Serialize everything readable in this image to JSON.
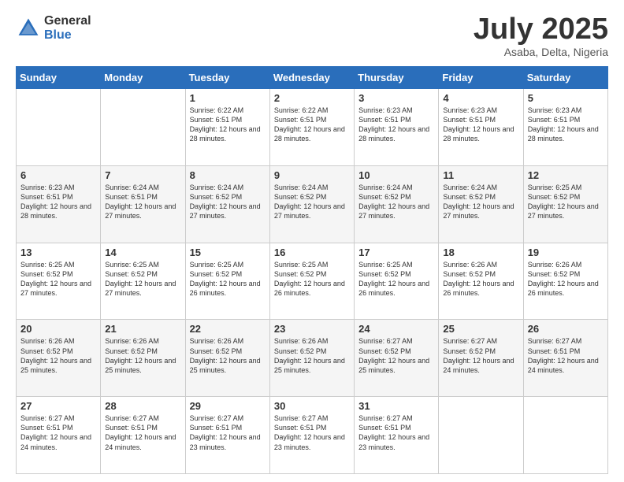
{
  "logo": {
    "general": "General",
    "blue": "Blue"
  },
  "header": {
    "month": "July 2025",
    "location": "Asaba, Delta, Nigeria"
  },
  "days_of_week": [
    "Sunday",
    "Monday",
    "Tuesday",
    "Wednesday",
    "Thursday",
    "Friday",
    "Saturday"
  ],
  "weeks": [
    [
      {
        "day": "",
        "sunrise": "",
        "sunset": "",
        "daylight": ""
      },
      {
        "day": "",
        "sunrise": "",
        "sunset": "",
        "daylight": ""
      },
      {
        "day": "1",
        "sunrise": "Sunrise: 6:22 AM",
        "sunset": "Sunset: 6:51 PM",
        "daylight": "Daylight: 12 hours and 28 minutes."
      },
      {
        "day": "2",
        "sunrise": "Sunrise: 6:22 AM",
        "sunset": "Sunset: 6:51 PM",
        "daylight": "Daylight: 12 hours and 28 minutes."
      },
      {
        "day": "3",
        "sunrise": "Sunrise: 6:23 AM",
        "sunset": "Sunset: 6:51 PM",
        "daylight": "Daylight: 12 hours and 28 minutes."
      },
      {
        "day": "4",
        "sunrise": "Sunrise: 6:23 AM",
        "sunset": "Sunset: 6:51 PM",
        "daylight": "Daylight: 12 hours and 28 minutes."
      },
      {
        "day": "5",
        "sunrise": "Sunrise: 6:23 AM",
        "sunset": "Sunset: 6:51 PM",
        "daylight": "Daylight: 12 hours and 28 minutes."
      }
    ],
    [
      {
        "day": "6",
        "sunrise": "Sunrise: 6:23 AM",
        "sunset": "Sunset: 6:51 PM",
        "daylight": "Daylight: 12 hours and 28 minutes."
      },
      {
        "day": "7",
        "sunrise": "Sunrise: 6:24 AM",
        "sunset": "Sunset: 6:51 PM",
        "daylight": "Daylight: 12 hours and 27 minutes."
      },
      {
        "day": "8",
        "sunrise": "Sunrise: 6:24 AM",
        "sunset": "Sunset: 6:52 PM",
        "daylight": "Daylight: 12 hours and 27 minutes."
      },
      {
        "day": "9",
        "sunrise": "Sunrise: 6:24 AM",
        "sunset": "Sunset: 6:52 PM",
        "daylight": "Daylight: 12 hours and 27 minutes."
      },
      {
        "day": "10",
        "sunrise": "Sunrise: 6:24 AM",
        "sunset": "Sunset: 6:52 PM",
        "daylight": "Daylight: 12 hours and 27 minutes."
      },
      {
        "day": "11",
        "sunrise": "Sunrise: 6:24 AM",
        "sunset": "Sunset: 6:52 PM",
        "daylight": "Daylight: 12 hours and 27 minutes."
      },
      {
        "day": "12",
        "sunrise": "Sunrise: 6:25 AM",
        "sunset": "Sunset: 6:52 PM",
        "daylight": "Daylight: 12 hours and 27 minutes."
      }
    ],
    [
      {
        "day": "13",
        "sunrise": "Sunrise: 6:25 AM",
        "sunset": "Sunset: 6:52 PM",
        "daylight": "Daylight: 12 hours and 27 minutes."
      },
      {
        "day": "14",
        "sunrise": "Sunrise: 6:25 AM",
        "sunset": "Sunset: 6:52 PM",
        "daylight": "Daylight: 12 hours and 27 minutes."
      },
      {
        "day": "15",
        "sunrise": "Sunrise: 6:25 AM",
        "sunset": "Sunset: 6:52 PM",
        "daylight": "Daylight: 12 hours and 26 minutes."
      },
      {
        "day": "16",
        "sunrise": "Sunrise: 6:25 AM",
        "sunset": "Sunset: 6:52 PM",
        "daylight": "Daylight: 12 hours and 26 minutes."
      },
      {
        "day": "17",
        "sunrise": "Sunrise: 6:25 AM",
        "sunset": "Sunset: 6:52 PM",
        "daylight": "Daylight: 12 hours and 26 minutes."
      },
      {
        "day": "18",
        "sunrise": "Sunrise: 6:26 AM",
        "sunset": "Sunset: 6:52 PM",
        "daylight": "Daylight: 12 hours and 26 minutes."
      },
      {
        "day": "19",
        "sunrise": "Sunrise: 6:26 AM",
        "sunset": "Sunset: 6:52 PM",
        "daylight": "Daylight: 12 hours and 26 minutes."
      }
    ],
    [
      {
        "day": "20",
        "sunrise": "Sunrise: 6:26 AM",
        "sunset": "Sunset: 6:52 PM",
        "daylight": "Daylight: 12 hours and 25 minutes."
      },
      {
        "day": "21",
        "sunrise": "Sunrise: 6:26 AM",
        "sunset": "Sunset: 6:52 PM",
        "daylight": "Daylight: 12 hours and 25 minutes."
      },
      {
        "day": "22",
        "sunrise": "Sunrise: 6:26 AM",
        "sunset": "Sunset: 6:52 PM",
        "daylight": "Daylight: 12 hours and 25 minutes."
      },
      {
        "day": "23",
        "sunrise": "Sunrise: 6:26 AM",
        "sunset": "Sunset: 6:52 PM",
        "daylight": "Daylight: 12 hours and 25 minutes."
      },
      {
        "day": "24",
        "sunrise": "Sunrise: 6:27 AM",
        "sunset": "Sunset: 6:52 PM",
        "daylight": "Daylight: 12 hours and 25 minutes."
      },
      {
        "day": "25",
        "sunrise": "Sunrise: 6:27 AM",
        "sunset": "Sunset: 6:52 PM",
        "daylight": "Daylight: 12 hours and 24 minutes."
      },
      {
        "day": "26",
        "sunrise": "Sunrise: 6:27 AM",
        "sunset": "Sunset: 6:51 PM",
        "daylight": "Daylight: 12 hours and 24 minutes."
      }
    ],
    [
      {
        "day": "27",
        "sunrise": "Sunrise: 6:27 AM",
        "sunset": "Sunset: 6:51 PM",
        "daylight": "Daylight: 12 hours and 24 minutes."
      },
      {
        "day": "28",
        "sunrise": "Sunrise: 6:27 AM",
        "sunset": "Sunset: 6:51 PM",
        "daylight": "Daylight: 12 hours and 24 minutes."
      },
      {
        "day": "29",
        "sunrise": "Sunrise: 6:27 AM",
        "sunset": "Sunset: 6:51 PM",
        "daylight": "Daylight: 12 hours and 23 minutes."
      },
      {
        "day": "30",
        "sunrise": "Sunrise: 6:27 AM",
        "sunset": "Sunset: 6:51 PM",
        "daylight": "Daylight: 12 hours and 23 minutes."
      },
      {
        "day": "31",
        "sunrise": "Sunrise: 6:27 AM",
        "sunset": "Sunset: 6:51 PM",
        "daylight": "Daylight: 12 hours and 23 minutes."
      },
      {
        "day": "",
        "sunrise": "",
        "sunset": "",
        "daylight": ""
      },
      {
        "day": "",
        "sunrise": "",
        "sunset": "",
        "daylight": ""
      }
    ]
  ]
}
